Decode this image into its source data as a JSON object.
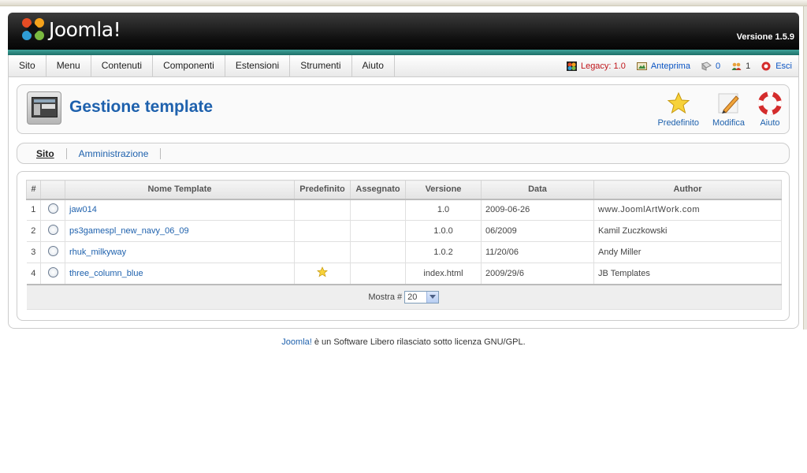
{
  "header": {
    "brand": "Joomla!",
    "version": "Versione 1.5.9"
  },
  "menu": [
    "Sito",
    "Menu",
    "Contenuti",
    "Componenti",
    "Estensioni",
    "Strumenti",
    "Aiuto"
  ],
  "status": {
    "legacy": "Legacy: 1.0",
    "preview": "Anteprima",
    "messages": "0",
    "users": "1",
    "logout": "Esci"
  },
  "page": {
    "title": "Gestione template"
  },
  "toolbar": {
    "default_label": "Predefinito",
    "edit_label": "Modifica",
    "help_label": "Aiuto"
  },
  "tabs": [
    "Sito",
    "Amministrazione"
  ],
  "table": {
    "headers": [
      "#",
      "Nome Template",
      "Predefinito",
      "Assegnato",
      "Versione",
      "Data",
      "Author"
    ],
    "rows": [
      {
        "num": "1",
        "name": "jaw014",
        "default": false,
        "version": "1.0",
        "date": "2009-06-26",
        "author": "www.JoomlArtWork.com"
      },
      {
        "num": "2",
        "name": "ps3gamespl_new_navy_06_09",
        "default": false,
        "version": "1.0.0",
        "date": "06/2009",
        "author": "Kamil Zuczkowski"
      },
      {
        "num": "3",
        "name": "rhuk_milkyway",
        "default": false,
        "version": "1.0.2",
        "date": "11/20/06",
        "author": "Andy Miller"
      },
      {
        "num": "4",
        "name": "three_column_blue",
        "default": true,
        "version": "index.html",
        "date": "2009/29/6",
        "author": "JB Templates"
      }
    ],
    "display_label": "Mostra #",
    "display_value": "20"
  },
  "footer": {
    "link": "Joomla!",
    "text": " è un Software Libero rilasciato sotto licenza GNU/GPL."
  },
  "colors": {
    "link": "#1e61ad",
    "legacy": "#c0161b",
    "teal": "#2a8a82"
  }
}
